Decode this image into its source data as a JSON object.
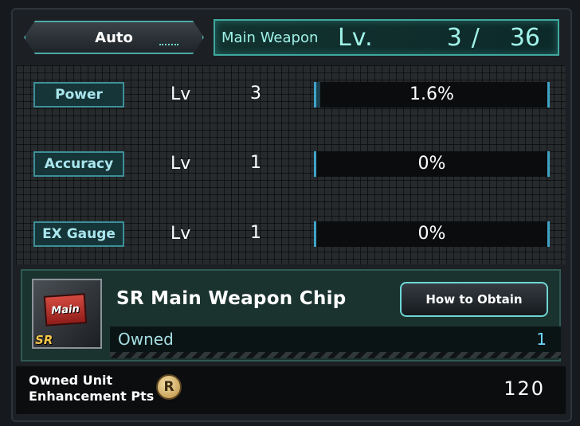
{
  "auto_button": {
    "label": "Auto"
  },
  "main_weapon": {
    "label": "Main Weapon",
    "lv_label": "Lv.",
    "current": "3",
    "separator": "/",
    "max": "36"
  },
  "stats": [
    {
      "name": "Power",
      "lv_label": "Lv",
      "level": "3",
      "percent_text": "1.6%",
      "percent_value": 1.6
    },
    {
      "name": "Accuracy",
      "lv_label": "Lv",
      "level": "1",
      "percent_text": "0%",
      "percent_value": 0
    },
    {
      "name": "EX Gauge",
      "lv_label": "Lv",
      "level": "1",
      "percent_text": "0%",
      "percent_value": 0
    }
  ],
  "chip": {
    "icon_text": "Main",
    "rarity_badge": "SR",
    "name": "SR Main Weapon Chip",
    "obtain_button": "How to Obtain",
    "owned_label": "Owned",
    "owned_count": "1"
  },
  "footer": {
    "pts_label_line1": "Owned Unit",
    "pts_label_line2": "Enhancement Pts",
    "coin_symbol": "R",
    "pts_value": "120"
  },
  "colors": {
    "accent": "#3fa9a0",
    "bar_border": "#3fa4c8",
    "owned_count": "#6fd7ff"
  }
}
